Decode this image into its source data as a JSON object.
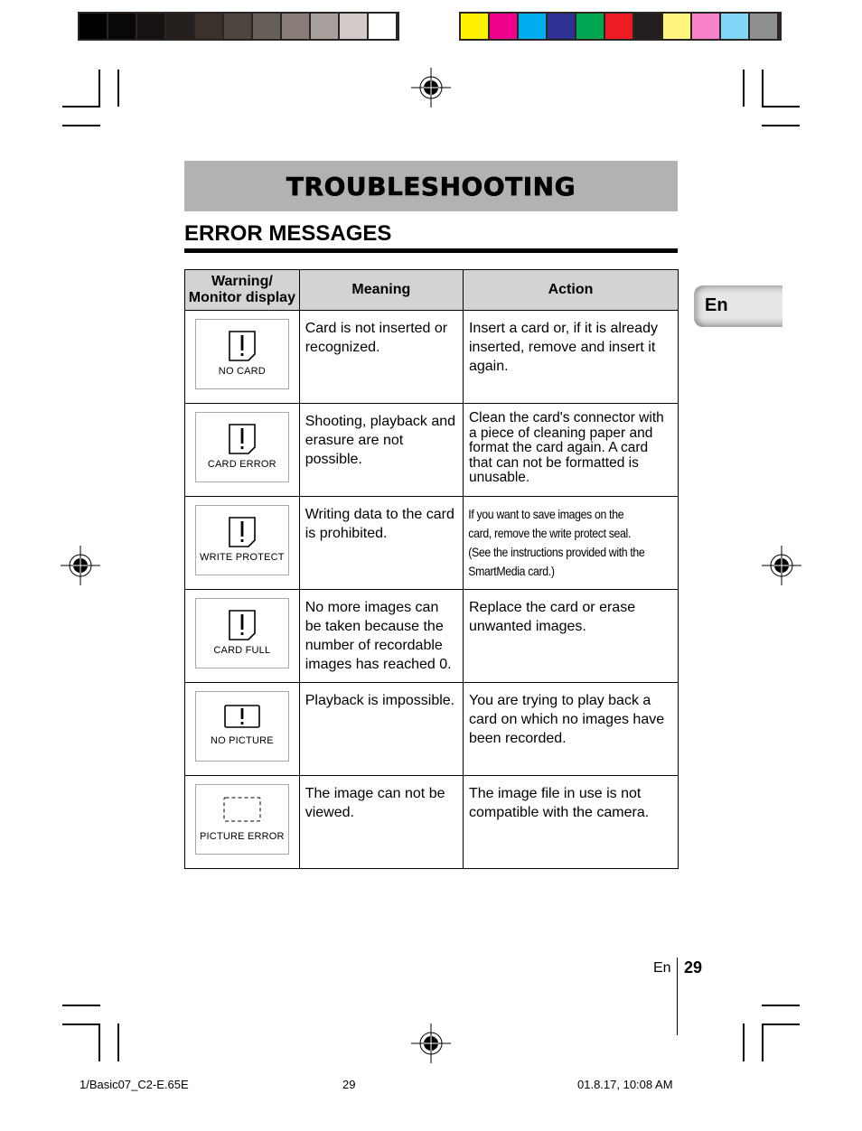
{
  "print_marks": {
    "gray_swatches": [
      "#000000",
      "#0a0806",
      "#151211",
      "#25201d",
      "#3a302c",
      "#4e4541",
      "#685e5a",
      "#877c78",
      "#a8a09d",
      "#d3cbca",
      "#ffffff"
    ],
    "color_swatches": [
      "#fff200",
      "#ec008c",
      "#00aeef",
      "#2e3192",
      "#00a651",
      "#ed1c24",
      "#231f20",
      "#fff57f",
      "#f782c8",
      "#7fd6f7",
      "#8f8f8f"
    ]
  },
  "header": {
    "title": "TROUBLESHOOTING",
    "section_title": "ERROR MESSAGES"
  },
  "side_tab": {
    "label": "En"
  },
  "table": {
    "columns": [
      "Warning/\nMonitor display",
      "Meaning",
      "Action"
    ],
    "column_lines": [
      [
        "Warning/",
        "Monitor display"
      ],
      [
        "Meaning"
      ],
      [
        "Action"
      ]
    ],
    "rows": [
      {
        "display": "NO CARD",
        "icon": "card-warning-icon",
        "meaning": "Card is not inserted or recognized.",
        "action": "Insert a card or, if it is already inserted, remove and insert it again."
      },
      {
        "display": "CARD ERROR",
        "icon": "card-warning-icon",
        "meaning": "Shooting, playback and erasure are not possible.",
        "action": "Clean the card's connector with a piece of cleaning paper and format the card again. A card that can not be formatted is unusable."
      },
      {
        "display": "WRITE PROTECT",
        "icon": "card-warning-icon",
        "meaning": "Writing data to the card is prohibited.",
        "action": "If you want to save images on the card, remove the write protect seal. (See the  instructions provided with the SmartMedia card.)"
      },
      {
        "display": "CARD FULL",
        "icon": "card-warning-icon",
        "meaning": "No more images can be taken because the number of recordable images has reached 0.",
        "action": "Replace the card or erase unwanted images."
      },
      {
        "display": "NO PICTURE",
        "icon": "picture-warning-icon",
        "meaning": "Playback is impossible.",
        "action": "You are trying to play back a card on which no images have been recorded."
      },
      {
        "display": "PICTURE ERROR",
        "icon": "dashed-frame-icon",
        "meaning": "The image can not be viewed.",
        "action": "The image file in use is not compatible with the camera."
      }
    ]
  },
  "folio": {
    "lang": "En",
    "page": "29"
  },
  "slug": {
    "file": "1/Basic07_C2-E.65E",
    "page": "29",
    "timestamp": "01.8.17, 10:08 AM"
  }
}
